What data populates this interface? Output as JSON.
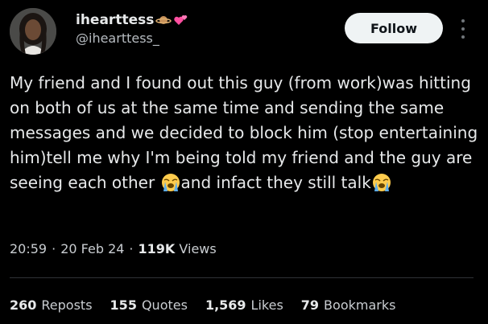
{
  "user": {
    "display_name": "iheartt​ess",
    "handle": "@iheartt​ess_"
  },
  "follow_button": {
    "label": "Follow"
  },
  "tweet": {
    "text_part1": "My friend  and I found out this guy (from work)was hitting on both of us at the same time and sending the same messages and we decided to block him (stop entertaining him)tell me why I'm being told my friend and the guy are seeing each other",
    "text_part2": "and infact they still talk"
  },
  "meta": {
    "time": "20:59",
    "date": "20 Feb 24",
    "views_count": "119K",
    "views_label": "Views"
  },
  "stats": {
    "reposts": {
      "count": "260",
      "label": "Reposts"
    },
    "quotes": {
      "count": "155",
      "label": "Quotes"
    },
    "likes": {
      "count": "1,569",
      "label": "Likes"
    },
    "bookmarks": {
      "count": "79",
      "label": "Bookmarks"
    }
  },
  "icons": {
    "verified_decoration": [
      "planet-icon",
      "hearts-icon"
    ],
    "emoji": "loudly-crying-face-icon"
  }
}
